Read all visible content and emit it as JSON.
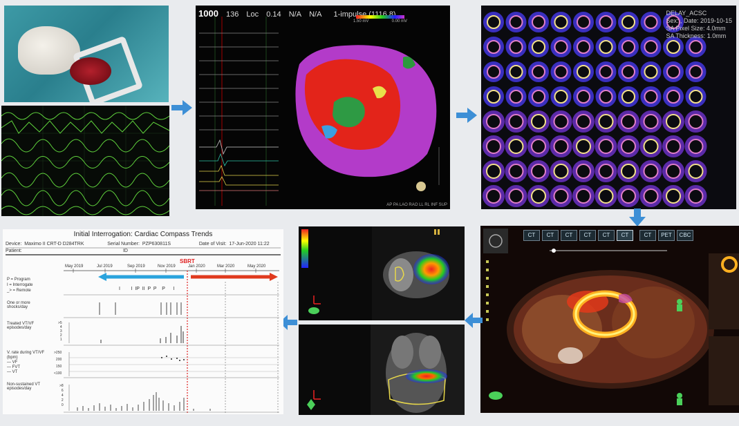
{
  "colors": {
    "arrow": "#3d8fd6",
    "sbrt_line": "#e02020",
    "pre_bar": "#2aa3dd",
    "post_bar": "#e03a1e"
  },
  "eamap": {
    "header": {
      "rate": "1000",
      "v1": "136",
      "v1_label": "Loc",
      "v2": "0.14",
      "v3": "N/A",
      "v4": "N/A",
      "region": "1-impulse (1116.8)"
    },
    "scale": {
      "min": "1.50 mV",
      "max": "0.00 mV"
    },
    "footer": "AP PA LAO RAO LL RL INF SUP"
  },
  "spect": {
    "label_lines": [
      "DELAY_ACSC",
      "Sex: , Date: 2019-10-15",
      "SA Pixel Size: 4.0mm",
      "SA Thickness: 1.0mm"
    ]
  },
  "compass": {
    "title": "Initial Interrogation: Cardiac Compass Trends",
    "device_label": "Device:",
    "device_value": "Maximo II CRT-D D284TRK",
    "serial_label": "Serial Number:",
    "serial_value": "PZP630811S",
    "visit_label": "Date of Visit:",
    "visit_value": "17-Jun-2020 11:22",
    "patient_label": "Patient:",
    "id_label": "ID",
    "months": [
      "May 2019",
      "Jul 2019",
      "Sep 2019",
      "Nov 2019",
      "Jan 2020",
      "Mar 2020",
      "May 2020"
    ],
    "sbrt_label": "SBRT",
    "legend": [
      "P = Program",
      "I = Interrogate",
      "_> = Remote"
    ],
    "events": "I        I  IP  II  P  P    P      I",
    "rows": [
      {
        "label": [
          "One or more",
          "shocks/day"
        ]
      },
      {
        "label": [
          "Treated VT/VF",
          "episodes/day"
        ],
        "ticks": [
          ">5",
          "4",
          "3",
          "2",
          "1"
        ]
      },
      {
        "label": [
          "V. rate during VT/VF",
          "(bpm)",
          "— VF",
          "— FVT",
          "— VT"
        ],
        "ticks": [
          ">250",
          "200",
          "150",
          "<100"
        ]
      },
      {
        "label": [
          "Non-sustained VT",
          "episodes/day"
        ],
        "ticks": [
          ">8",
          "6",
          "4",
          "2",
          "0"
        ]
      }
    ]
  },
  "petct": {
    "tabs": [
      "CT",
      "CT",
      "CT",
      "CT",
      "CT",
      "CT",
      "CT",
      "PET",
      "CBC"
    ],
    "selected_tab": 5
  }
}
